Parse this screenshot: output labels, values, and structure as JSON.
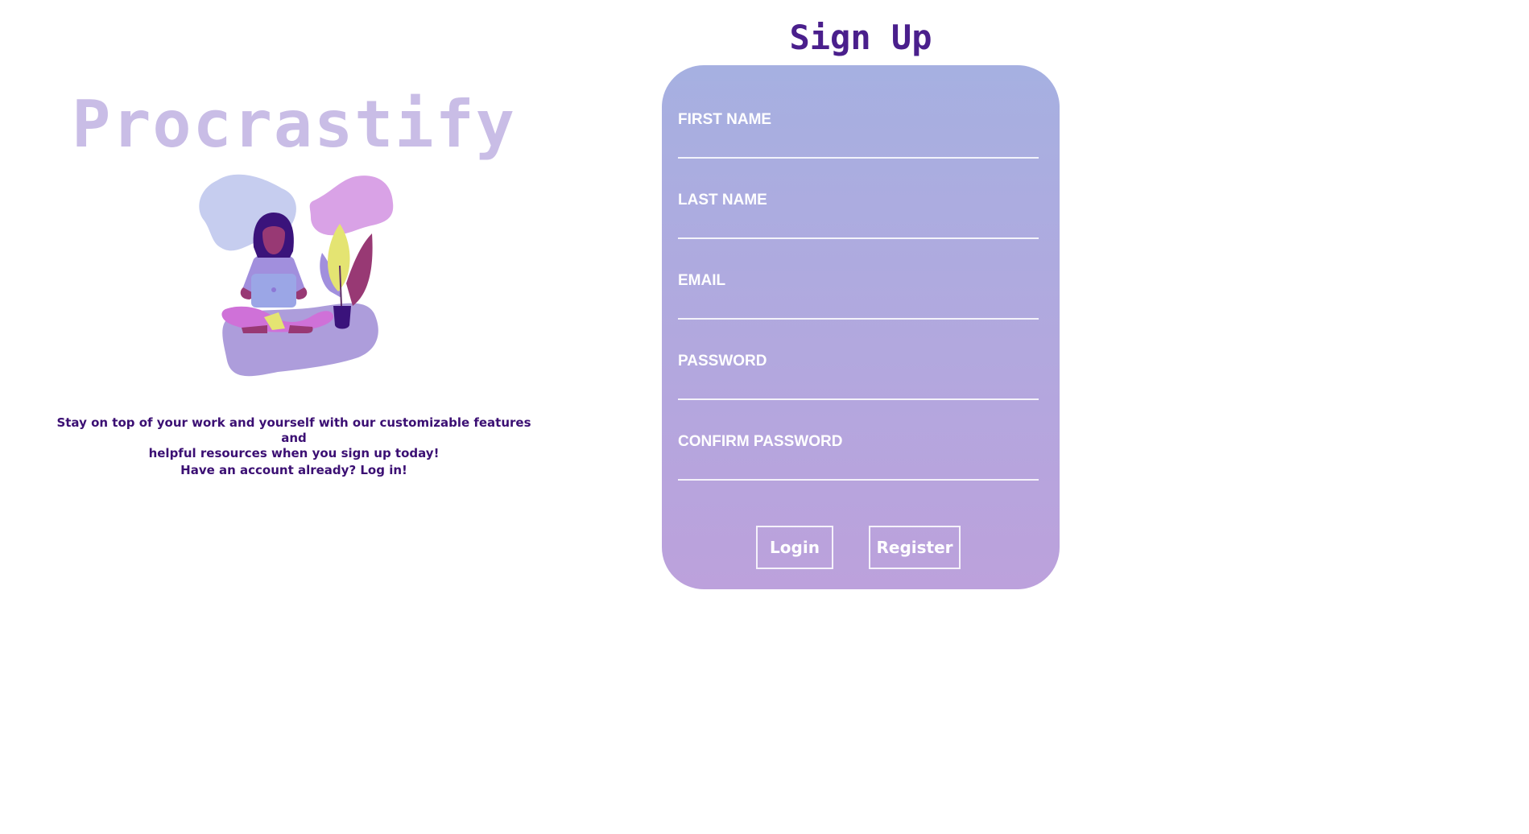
{
  "brand": {
    "title": "Procrastify",
    "title_color": "#c9bde6"
  },
  "intro": {
    "tagline_line1": "Stay on top of your work and yourself with our customizable features and",
    "tagline_line2": "helpful resources when you sign up today!",
    "login_prompt": "Have an account already? Log in!",
    "text_color": "#3b0f73"
  },
  "illustration": {
    "icon": "woman-with-laptop-and-plant-illustration"
  },
  "form": {
    "heading": "Sign Up",
    "heading_color": "#4a1f8c",
    "gradient_top": "#a6b0e1",
    "gradient_bottom": "#bca1dc",
    "fields": [
      {
        "label": "FIRST NAME",
        "value": ""
      },
      {
        "label": "LAST NAME",
        "value": ""
      },
      {
        "label": "EMAIL",
        "value": ""
      },
      {
        "label": "PASSWORD",
        "value": ""
      },
      {
        "label": "CONFIRM PASSWORD",
        "value": ""
      }
    ],
    "buttons": {
      "login": "Login",
      "register": "Register"
    }
  }
}
